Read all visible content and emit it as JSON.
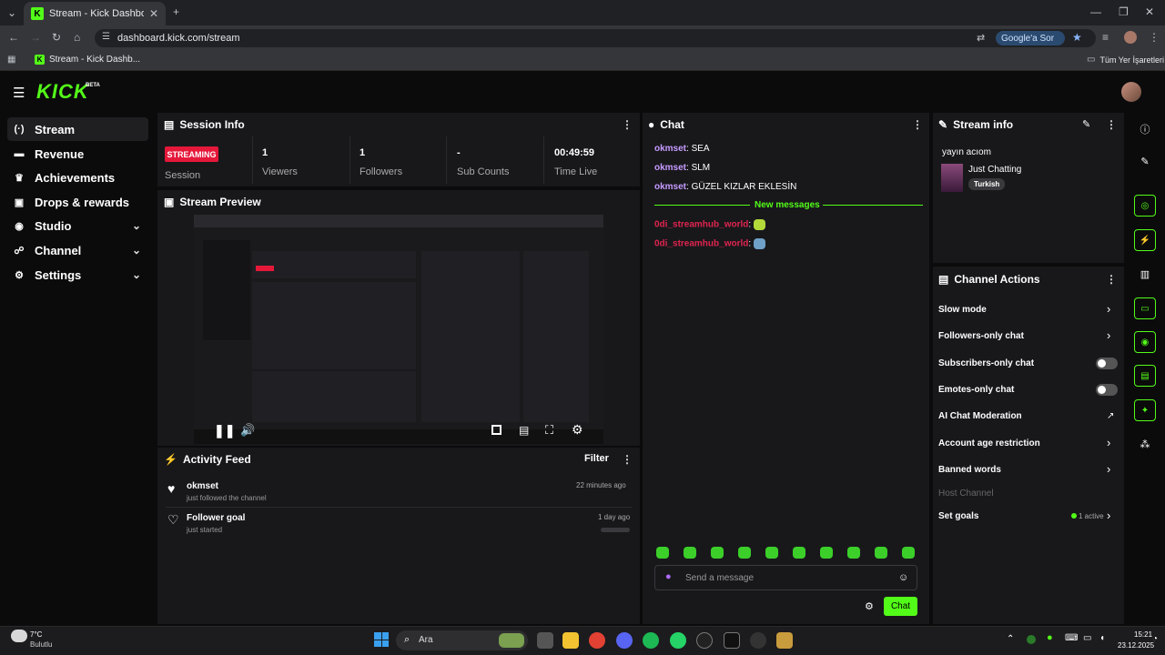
{
  "browser": {
    "tab_title": "Stream - Kick Dashboard",
    "url": "dashboard.kick.com/stream",
    "google_btn": "Google'a Sor",
    "bookmark": "Stream - Kick Dashb...",
    "other_bookmarks": "Tüm Yer İşaretleri"
  },
  "app": {
    "logo": "KICK",
    "beta": "BETA"
  },
  "sidebar": {
    "items": [
      {
        "label": "Stream",
        "icon": "broadcast-icon"
      },
      {
        "label": "Revenue",
        "icon": "revenue-icon"
      },
      {
        "label": "Achievements",
        "icon": "trophy-icon"
      },
      {
        "label": "Drops & rewards",
        "icon": "gift-icon"
      },
      {
        "label": "Studio",
        "icon": "studio-icon"
      },
      {
        "label": "Channel",
        "icon": "channel-icon"
      },
      {
        "label": "Settings",
        "icon": "gear-icon"
      }
    ]
  },
  "session": {
    "title": "Session Info",
    "status_badge": "STREAMING",
    "status_label": "Session",
    "viewers": "1",
    "viewers_label": "Viewers",
    "followers": "1",
    "followers_label": "Followers",
    "subs": "-",
    "subs_label": "Sub Counts",
    "time": "00:49:59",
    "time_label": "Time Live"
  },
  "preview": {
    "title": "Stream Preview"
  },
  "activity": {
    "title": "Activity Feed",
    "filter": "Filter",
    "items": [
      {
        "name": "okmset",
        "desc": "just followed the channel",
        "time": "22 minutes ago"
      },
      {
        "name": "Follower goal",
        "desc": "just started",
        "time": "1 day ago"
      }
    ]
  },
  "chat": {
    "title": "Chat",
    "messages": [
      {
        "user": "okmset",
        "text": "SEA"
      },
      {
        "user": "okmset",
        "text": "SLM"
      },
      {
        "user": "okmset",
        "text": "GÜZEL KIZLAR EKLESİN"
      }
    ],
    "new_messages": "New messages",
    "new": [
      {
        "user": "0di_streamhub_world",
        "text": ":"
      },
      {
        "user": "0di_streamhub_world",
        "text": ":"
      }
    ],
    "placeholder": "Send a message",
    "send": "Chat"
  },
  "stream_info": {
    "title": "Stream info",
    "stream_title": "yayın acıom",
    "category": "Just Chatting",
    "language": "Turkish"
  },
  "channel_actions": {
    "title": "Channel Actions",
    "items": [
      "Slow mode",
      "Followers-only chat",
      "Subscribers-only chat",
      "Emotes-only chat",
      "AI Chat Moderation",
      "Account age restriction",
      "Banned words",
      "Host Channel",
      "Set goals"
    ],
    "set_goals_status": "1 active"
  },
  "taskbar": {
    "weather_temp": "7°C",
    "weather_desc": "Bulutlu",
    "search": "Ara",
    "time": "15:21",
    "date": "23.12.2025"
  },
  "colors": {
    "accent": "#53fc18",
    "live": "#e5183a",
    "panel": "#18181b"
  }
}
